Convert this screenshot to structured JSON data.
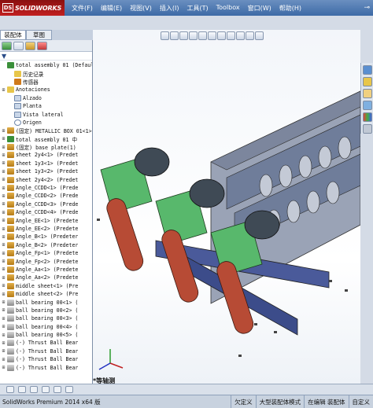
{
  "app": {
    "logo_mark": "DS",
    "logo_text": "SOLIDWORKS"
  },
  "menus": [
    "文件(F)",
    "编辑(E)",
    "视图(V)",
    "插入(I)",
    "工具(T)",
    "Toolbox",
    "窗口(W)",
    "帮助(H)"
  ],
  "pin_icon": "pin-icon",
  "panel_tabs": [
    "装配体",
    "草图"
  ],
  "filter_symbol": "▼",
  "tree": [
    {
      "label": "total assembly 01  (Default<",
      "icon": "asm",
      "exp": "",
      "indent": 0
    },
    {
      "label": "历史记录",
      "icon": "fold",
      "exp": "",
      "indent": 1
    },
    {
      "label": "传感器",
      "icon": "sens",
      "exp": "",
      "indent": 1
    },
    {
      "label": "Anotaciones",
      "icon": "fold",
      "exp": "⊞",
      "indent": 0
    },
    {
      "label": "Alzado",
      "icon": "plane",
      "exp": "",
      "indent": 1
    },
    {
      "label": "Planta",
      "icon": "plane",
      "exp": "",
      "indent": 1
    },
    {
      "label": "Vista lateral",
      "icon": "plane",
      "exp": "",
      "indent": 1
    },
    {
      "label": "Origen",
      "icon": "orig",
      "exp": "",
      "indent": 1
    },
    {
      "label": "(固定) METALLIC BOX 01<1>",
      "icon": "part",
      "exp": "⊞",
      "indent": 0
    },
    {
      "label": "total assembly 01 中",
      "icon": "asm",
      "exp": "⊞",
      "indent": 0
    },
    {
      "label": "(固定) base plate(1)",
      "icon": "part",
      "exp": "⊞",
      "indent": 0
    },
    {
      "label": "sheet 2y4<1> (Predet",
      "icon": "part",
      "exp": "⊞",
      "indent": 0
    },
    {
      "label": "sheet 1y3<1> (Predet",
      "icon": "part",
      "exp": "⊞",
      "indent": 0
    },
    {
      "label": "sheet 1y3<2> (Predet",
      "icon": "part",
      "exp": "⊞",
      "indent": 0
    },
    {
      "label": "sheet 2y4<2> (Predet",
      "icon": "part",
      "exp": "⊞",
      "indent": 0
    },
    {
      "label": "Angle_CCDD<1> (Prede",
      "icon": "part",
      "exp": "⊞",
      "indent": 0
    },
    {
      "label": "Angle_CCDD<2> (Prede",
      "icon": "part",
      "exp": "⊞",
      "indent": 0
    },
    {
      "label": "Angle_CCDD<3> (Prede",
      "icon": "part",
      "exp": "⊞",
      "indent": 0
    },
    {
      "label": "Angle_CCDD<4> (Prede",
      "icon": "part",
      "exp": "⊞",
      "indent": 0
    },
    {
      "label": "Angle_EE<1> (Predete",
      "icon": "part",
      "exp": "⊞",
      "indent": 0
    },
    {
      "label": "Angle_EE<2> (Predete",
      "icon": "part",
      "exp": "⊞",
      "indent": 0
    },
    {
      "label": "Angle_B<1> (Predeter",
      "icon": "part",
      "exp": "⊞",
      "indent": 0
    },
    {
      "label": "Angle_B<2> (Predeter",
      "icon": "part",
      "exp": "⊞",
      "indent": 0
    },
    {
      "label": "Angle_Fp<1> (Predete",
      "icon": "part",
      "exp": "⊞",
      "indent": 0
    },
    {
      "label": "Angle_Fp<2> (Predete",
      "icon": "part",
      "exp": "⊞",
      "indent": 0
    },
    {
      "label": "Angle_Aa<1> (Predete",
      "icon": "part",
      "exp": "⊞",
      "indent": 0
    },
    {
      "label": "Angle_Aa<2> (Predete",
      "icon": "part",
      "exp": "⊞",
      "indent": 0
    },
    {
      "label": "middle sheet<1> (Pre",
      "icon": "part",
      "exp": "⊞",
      "indent": 0
    },
    {
      "label": "middle sheet<2> (Pre",
      "icon": "part",
      "exp": "⊞",
      "indent": 0
    },
    {
      "label": "ball bearing 00<1> (",
      "icon": "bear",
      "exp": "⊞",
      "indent": 0
    },
    {
      "label": "ball bearing 00<2> (",
      "icon": "bear",
      "exp": "⊞",
      "indent": 0
    },
    {
      "label": "ball bearing 00<3> (",
      "icon": "bear",
      "exp": "⊞",
      "indent": 0
    },
    {
      "label": "ball bearing 00<4> (",
      "icon": "bear",
      "exp": "⊞",
      "indent": 0
    },
    {
      "label": "ball bearing 00<5> (",
      "icon": "bear",
      "exp": "⊞",
      "indent": 0
    },
    {
      "label": "(-) Thrust Ball Bear",
      "icon": "bear",
      "exp": "⊞",
      "indent": 0
    },
    {
      "label": "(-) Thrust Ball Bear",
      "icon": "bear",
      "exp": "⊞",
      "indent": 0
    },
    {
      "label": "(-) Thrust Ball Bear",
      "icon": "bear",
      "exp": "⊞",
      "indent": 0
    },
    {
      "label": "(-) Thrust Ball Bear",
      "icon": "bear",
      "exp": "⊞",
      "indent": 0
    }
  ],
  "viewport": {
    "view_label": "*等轴测",
    "triad_icon": "axis-triad-icon"
  },
  "statusbar": {
    "left": "SolidWorks Premium 2014 x64 版",
    "fields": [
      "欠定义",
      "大型装配体模式",
      "在编辑 装配体",
      "自定义"
    ]
  },
  "colors": {
    "menubar": "#3d6aa6",
    "logo": "#c22020",
    "conveyor": "#6f7d9a",
    "gearbox": "#58b86c",
    "belt": "#b74b35",
    "motor": "#3f4a55"
  }
}
